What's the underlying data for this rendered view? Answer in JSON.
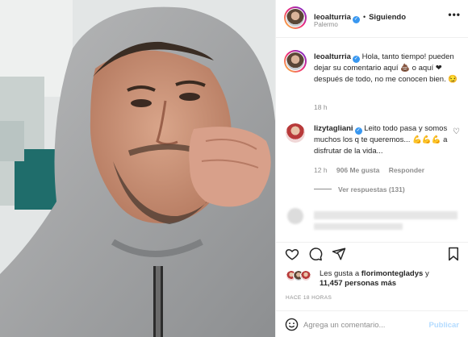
{
  "header": {
    "username": "leoalturria",
    "verified_glyph": "✓",
    "separator": "•",
    "follow_status": "Siguiendo",
    "location": "Palermo",
    "more_glyph": "•••"
  },
  "caption": {
    "username": "leoalturria",
    "text": "Hola, tanto tiempo! pueden dejar su comentario aquí 💩 o aquí ❤ después de todo, no me conocen bien. 😏",
    "time": "18 h"
  },
  "comment": {
    "username": "lizytagliani",
    "text": "Leito todo pasa y somos muchos los q te queremos... 💪💪💪 a disfrutar de la vida...",
    "time": "12 h",
    "likes": "906 Me gusta",
    "reply": "Responder",
    "heart_glyph": "♡"
  },
  "view_replies": "Ver respuestas (131)",
  "actions": {
    "like_icon": "heart-icon",
    "comment_icon": "comment-icon",
    "share_icon": "send-icon",
    "save_icon": "bookmark-icon"
  },
  "likes": {
    "prefix": "Les gusta a ",
    "user": "florimonteglad​ys",
    "mid": " y",
    "count": "11,457 personas más"
  },
  "time_ago": "HACE 18 HORAS",
  "comment_box": {
    "placeholder": "Agrega un comentario...",
    "publish": "Publicar",
    "emoji_icon": "smiley-icon"
  },
  "colors": {
    "verified": "#3897f0",
    "link_disabled": "#b3dbff",
    "meta": "#8e8e8e",
    "text": "#262626"
  }
}
